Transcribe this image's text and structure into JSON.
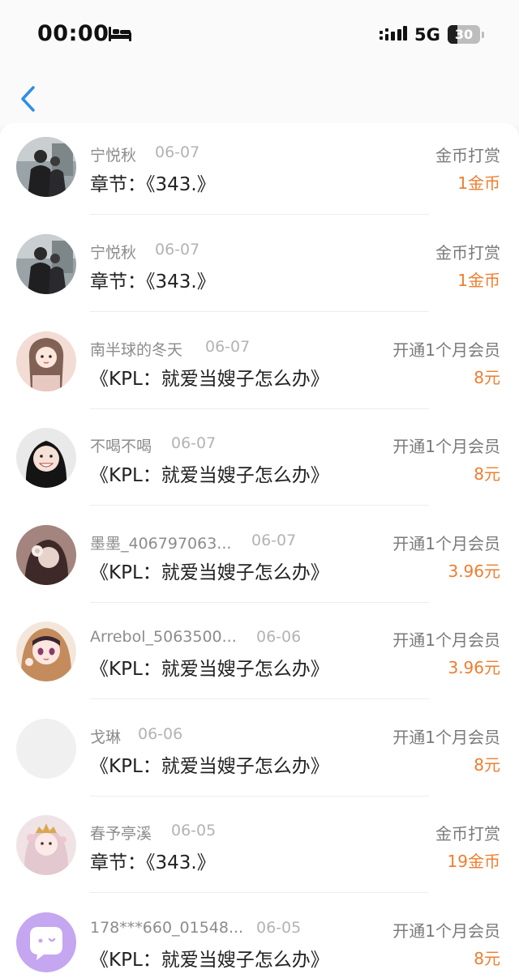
{
  "status_bar": {
    "time": "00:00",
    "network": "5G",
    "battery_level": "30",
    "battery_fraction": 0.3
  },
  "nav": {
    "back_icon": "chevron-left-icon",
    "accent_color": "#2f8ee5"
  },
  "colors": {
    "amount": "#f07d2e"
  },
  "records": [
    {
      "name": "宁悦秋",
      "date": "06-07",
      "title": "章节：《343.》",
      "type": "金币打赏",
      "amount": "1金币",
      "avatar": "photo-couple"
    },
    {
      "name": "宁悦秋",
      "date": "06-07",
      "title": "章节：《343.》",
      "type": "金币打赏",
      "amount": "1金币",
      "avatar": "photo-couple"
    },
    {
      "name": "南半球的冬天",
      "date": "06-07",
      "title": "《KPL：就爱当嫂子怎么办》",
      "type": "开通1个月会员",
      "amount": "8元",
      "avatar": "illustrated-girl"
    },
    {
      "name": "不喝不喝",
      "date": "06-07",
      "title": "《KPL：就爱当嫂子怎么办》",
      "type": "开通1个月会员",
      "amount": "8元",
      "avatar": "photo-smiling-girl"
    },
    {
      "name": "墨墨_406797063...",
      "date": "06-07",
      "title": "《KPL：就爱当嫂子怎么办》",
      "type": "开通1个月会员",
      "amount": "3.96元",
      "avatar": "photo-girl-flower"
    },
    {
      "name": "Arrebol_5063500...",
      "date": "06-06",
      "title": "《KPL：就爱当嫂子怎么办》",
      "type": "开通1个月会员",
      "amount": "3.96元",
      "avatar": "illustrated-girl-hood"
    },
    {
      "name": "戈琳",
      "date": "06-06",
      "title": "《KPL：就爱当嫂子怎么办》",
      "type": "开通1个月会员",
      "amount": "8元",
      "avatar": "blank-avatar"
    },
    {
      "name": "春予亭溪",
      "date": "06-05",
      "title": "章节：《343.》",
      "type": "金币打赏",
      "amount": "19金币",
      "avatar": "illustrated-girl-crown"
    },
    {
      "name": "178***660_01548...",
      "date": "06-05",
      "title": "《KPL：就爱当嫂子怎么办》",
      "type": "开通1个月会员",
      "amount": "8元",
      "avatar": "chat-bubble-icon"
    }
  ]
}
